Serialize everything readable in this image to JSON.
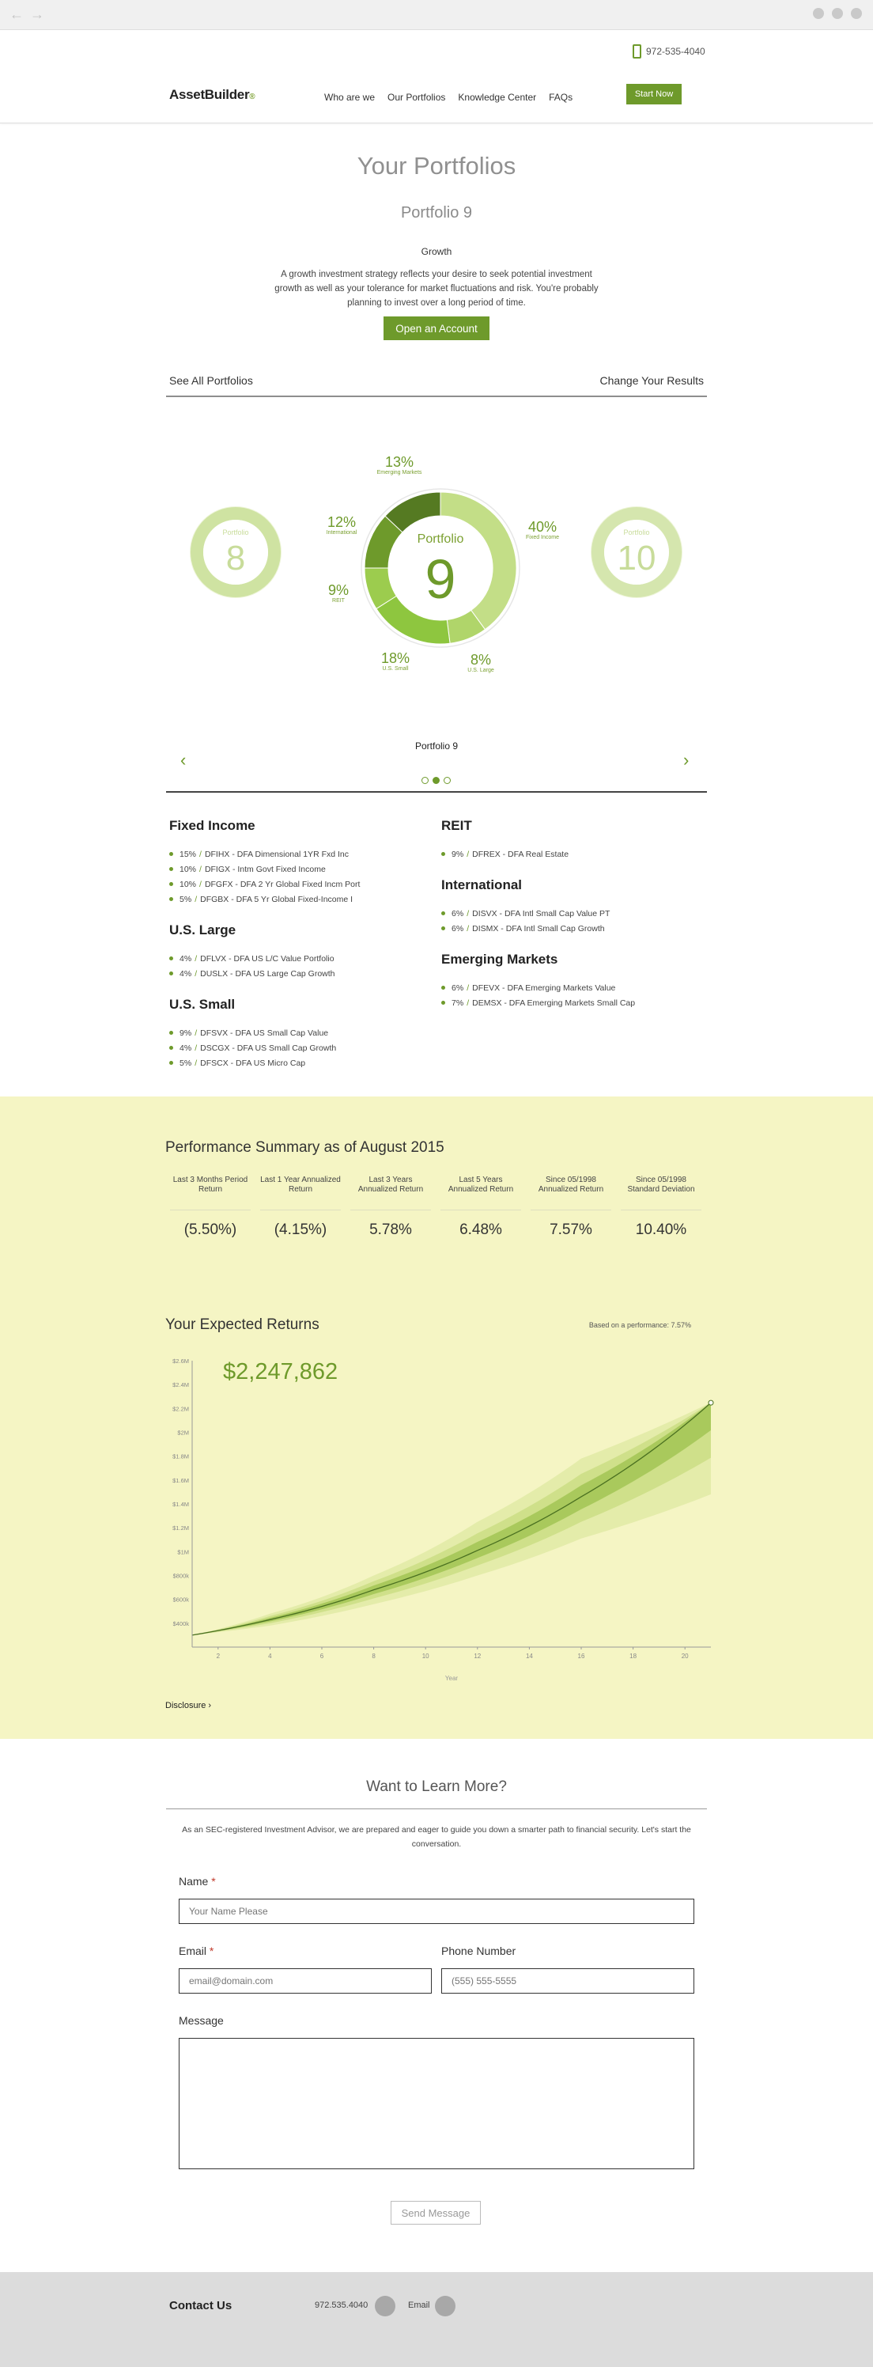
{
  "header": {
    "phone": "972-535-4040",
    "logo": "AssetBuilder",
    "nav": [
      "Who are we",
      "Our Portfolios",
      "Knowledge Center",
      "FAQs"
    ],
    "start_now": "Start Now"
  },
  "hero": {
    "title": "Your Portfolios",
    "portfolio_name": "Portfolio 9",
    "strategy": "Growth",
    "description": "A growth investment strategy reflects your desire to seek potential investment growth as well as your tolerance for market fluctuations and risk. You're probably planning to invest over a long period of time.",
    "open_account": "Open an Account",
    "see_all": "See All Portfolios",
    "change_results": "Change Your Results"
  },
  "donut": {
    "center_label": "Portfolio",
    "center_number": "9",
    "prev_label": "Portfolio",
    "prev_number": "8",
    "next_label": "Portfolio",
    "next_number": "10",
    "segments": [
      {
        "name": "Fixed Income",
        "pct": "40%",
        "value": 40,
        "color": "#c3de87"
      },
      {
        "name": "U.S. Large",
        "pct": "8%",
        "value": 8,
        "color": "#b0d56a"
      },
      {
        "name": "U.S. Small",
        "pct": "18%",
        "value": 18,
        "color": "#8ec63f"
      },
      {
        "name": "REIT",
        "pct": "9%",
        "value": 9,
        "color": "#9ccc4e"
      },
      {
        "name": "International",
        "pct": "12%",
        "value": 12,
        "color": "#6e9a2b"
      },
      {
        "name": "Emerging Markets",
        "pct": "13%",
        "value": 13,
        "color": "#557a22"
      }
    ]
  },
  "carousel": {
    "title": "Portfolio 9",
    "prev": "‹",
    "next": "›"
  },
  "holdings": {
    "fixed_income": {
      "title": "Fixed Income",
      "items": [
        {
          "pct": "15%",
          "text": "DFIHX - DFA Dimensional 1YR Fxd Inc"
        },
        {
          "pct": "10%",
          "text": "DFIGX - Intm Govt Fixed Income"
        },
        {
          "pct": "10%",
          "text": "DFGFX - DFA 2 Yr Global Fixed Incm Port"
        },
        {
          "pct": "5%",
          "text": "DFGBX - DFA 5 Yr Global Fixed-Income I"
        }
      ]
    },
    "us_large": {
      "title": "U.S. Large",
      "items": [
        {
          "pct": "4%",
          "text": "DFLVX - DFA US L/C Value Portfolio"
        },
        {
          "pct": "4%",
          "text": "DUSLX - DFA US Large Cap Growth"
        }
      ]
    },
    "us_small": {
      "title": "U.S. Small",
      "items": [
        {
          "pct": "9%",
          "text": "DFSVX - DFA US Small Cap Value"
        },
        {
          "pct": "4%",
          "text": "DSCGX - DFA US Small Cap Growth"
        },
        {
          "pct": "5%",
          "text": "DFSCX - DFA US Micro Cap"
        }
      ]
    },
    "reit": {
      "title": "REIT",
      "items": [
        {
          "pct": "9%",
          "text": "DFREX - DFA Real Estate"
        }
      ]
    },
    "international": {
      "title": "International",
      "items": [
        {
          "pct": "6%",
          "text": "DISVX - DFA Intl Small Cap Value PT"
        },
        {
          "pct": "6%",
          "text": "DISMX - DFA Intl Small Cap Growth"
        }
      ]
    },
    "emerging": {
      "title": "Emerging Markets",
      "items": [
        {
          "pct": "6%",
          "text": "DFEVX - DFA Emerging Markets Value"
        },
        {
          "pct": "7%",
          "text": "DEMSX - DFA Emerging Markets Small Cap"
        }
      ]
    }
  },
  "performance": {
    "title": "Performance Summary as of August 2015",
    "columns": [
      {
        "head": "Last 3 Months Period Return",
        "value": "(5.50%)"
      },
      {
        "head": "Last 1 Year Annualized Return",
        "value": "(4.15%)"
      },
      {
        "head": "Last 3 Years Annualized Return",
        "value": "5.78%"
      },
      {
        "head": "Last 5 Years Annualized Return",
        "value": "6.48%"
      },
      {
        "head": "Since 05/1998 Annualized Return",
        "value": "7.57%"
      },
      {
        "head": "Since 05/1998 Standard Deviation",
        "value": "10.40%"
      }
    ]
  },
  "returns": {
    "title": "Your Expected Returns",
    "note": "Based on a performance: 7.57%",
    "value": "$2,247,862",
    "disclosure": "Disclosure ›"
  },
  "chart_data": {
    "type": "area",
    "title": "Your Expected Returns",
    "xlabel": "Year",
    "ylabel": "",
    "x_ticks": [
      2,
      4,
      6,
      8,
      10,
      12,
      14,
      16,
      18,
      20
    ],
    "y_ticks": [
      "$400k",
      "$600k",
      "$800k",
      "$1M",
      "$1.2M",
      "$1.4M",
      "$1.6M",
      "$1.8M",
      "$2M",
      "$2.2M",
      "$2.4M",
      "$2.6M"
    ],
    "xlim": [
      1,
      21
    ],
    "ylim": [
      200000,
      2600000
    ],
    "series": [
      {
        "name": "Expected",
        "x": [
          1,
          4,
          8,
          12,
          16,
          21
        ],
        "values": [
          300000,
          430000,
          680000,
          1010000,
          1460000,
          2247862
        ]
      },
      {
        "name": "Upper band",
        "x": [
          1,
          4,
          8,
          12,
          16,
          21
        ],
        "values": [
          300000,
          480000,
          800000,
          1250000,
          1780000,
          2250000
        ]
      },
      {
        "name": "Lower band",
        "x": [
          1,
          4,
          8,
          12,
          16,
          21
        ],
        "values": [
          300000,
          380000,
          560000,
          800000,
          1110000,
          1480000
        ]
      }
    ]
  },
  "contact": {
    "title": "Want to Learn More?",
    "desc": "As an SEC-registered Investment Advisor, we are prepared and eager to guide you down a smarter path to financial security. Let's start the conversation.",
    "name_label": "Name",
    "name_placeholder": "Your Name Please",
    "email_label": "Email",
    "email_placeholder": "email@domain.com",
    "phone_label": "Phone Number",
    "phone_placeholder": "(555) 555-5555",
    "message_label": "Message",
    "send": "Send Message",
    "required_mark": "*"
  },
  "footer": {
    "contact_us": "Contact Us",
    "phone": "972.535.4040",
    "email": "Email"
  },
  "colors": {
    "brand_green": "#6e9a2b",
    "panel_yellow": "#f5f5c4"
  }
}
